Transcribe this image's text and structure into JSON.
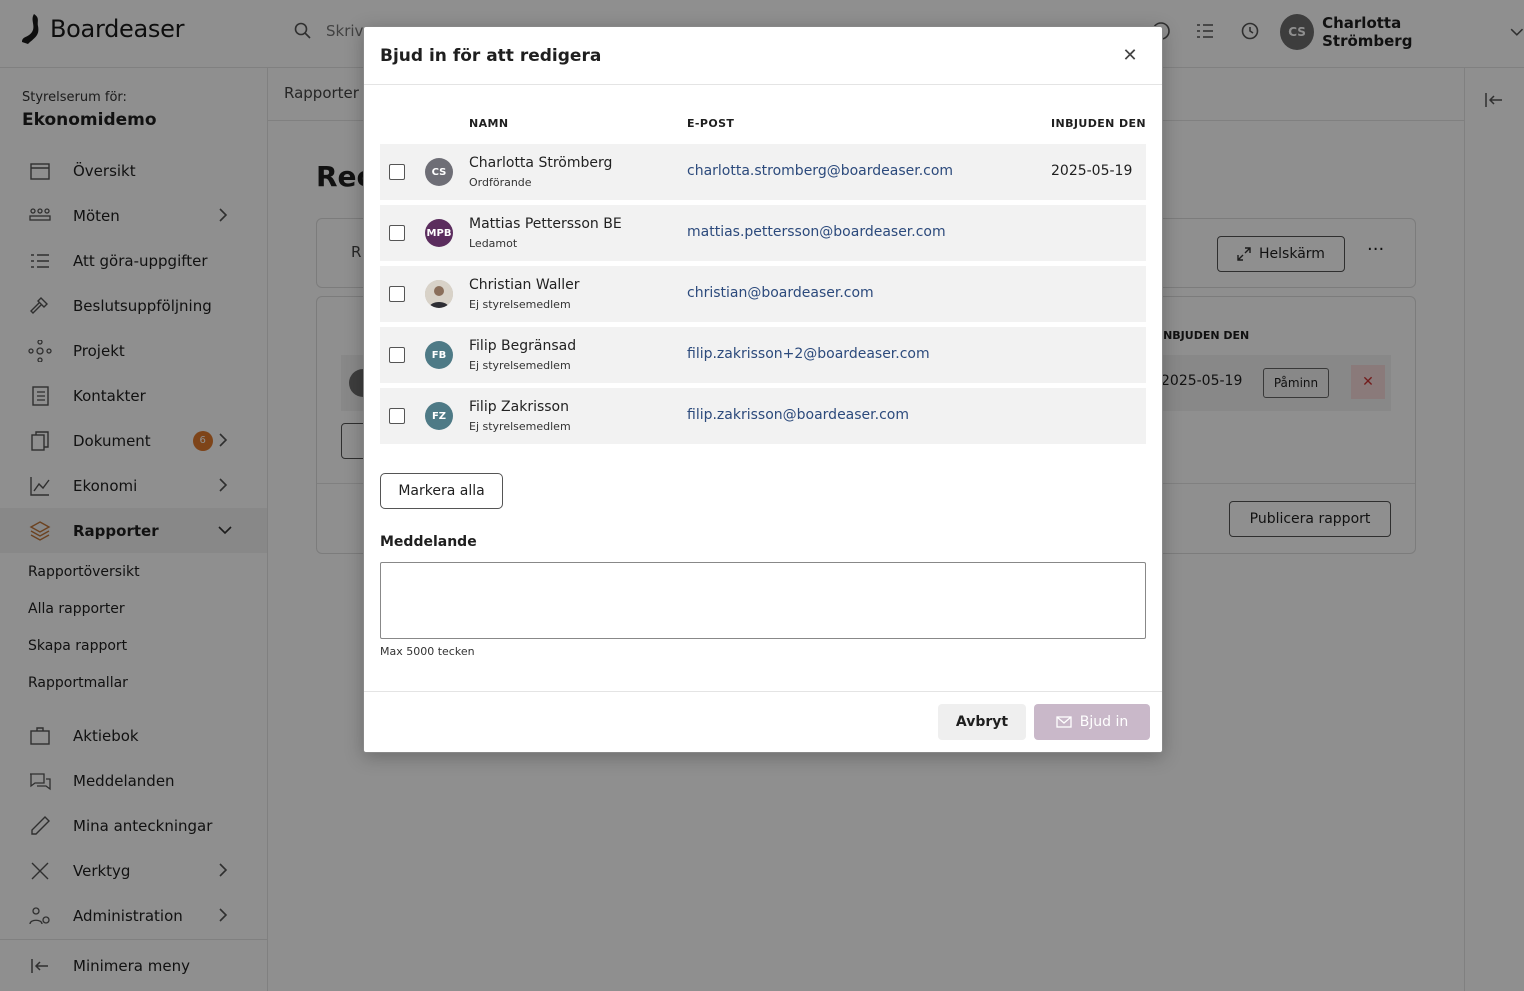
{
  "app": {
    "name": "Boardeaser",
    "search_placeholder": "Skriv"
  },
  "user": {
    "initials": "CS",
    "name": "Charlotta Strömberg"
  },
  "sidebar": {
    "room_label": "Styrelserum för:",
    "room_name": "Ekonomidemo",
    "items": [
      {
        "label": "Översikt",
        "icon": "calendar-icon"
      },
      {
        "label": "Möten",
        "icon": "people-table-icon"
      },
      {
        "label": "Att göra-uppgifter",
        "icon": "checklist-icon"
      },
      {
        "label": "Beslutsuppföljning",
        "icon": "gavel-icon"
      },
      {
        "label": "Projekt",
        "icon": "network-icon"
      },
      {
        "label": "Kontakter",
        "icon": "contacts-icon"
      },
      {
        "label": "Dokument",
        "icon": "documents-icon",
        "badge": "6"
      },
      {
        "label": "Ekonomi",
        "icon": "chart-line-icon"
      },
      {
        "label": "Rapporter",
        "icon": "layers-icon"
      },
      {
        "label": "Aktiebok",
        "icon": "briefcase-icon"
      },
      {
        "label": "Meddelanden",
        "icon": "chat-icon"
      },
      {
        "label": "Mina anteckningar",
        "icon": "pencil-icon"
      },
      {
        "label": "Verktyg",
        "icon": "tools-icon"
      },
      {
        "label": "Administration",
        "icon": "admin-users-icon"
      }
    ],
    "sub_items": [
      "Rapportöversikt",
      "Alla rapporter",
      "Skapa rapport",
      "Rapportmallar"
    ],
    "minimize_label": "Minimera meny"
  },
  "background": {
    "breadcrumb": "Rapporter",
    "page_title": "Rec",
    "card_label": "R",
    "fullscreen_label": "Helskärm",
    "invited_header": "INBJUDEN DEN",
    "invited_date": "2025-05-19",
    "remind_label": "Påminn",
    "publish_label": "Publicera rapport"
  },
  "modal": {
    "title": "Bjud in för att redigera",
    "columns": {
      "name": "NAMN",
      "email": "E-POST",
      "invited": "INBJUDEN DEN"
    },
    "rows": [
      {
        "initials": "CS",
        "name": "Charlotta Strömberg",
        "role": "Ordförande",
        "email": "charlotta.stromberg@boardeaser.com",
        "invited": "2025-05-19",
        "avatar_color": "#6e6e76"
      },
      {
        "initials": "MPB",
        "name": "Mattias Pettersson BE",
        "role": "Ledamot",
        "email": "mattias.pettersson@boardeaser.com",
        "invited": "",
        "avatar_color": "#5b2d5e"
      },
      {
        "initials": "",
        "name": "Christian Waller",
        "role": "Ej styrelsemedlem",
        "email": "christian@boardeaser.com",
        "invited": "",
        "avatar_color": "#c8c0b4"
      },
      {
        "initials": "FB",
        "name": "Filip Begränsad",
        "role": "Ej styrelsemedlem",
        "email": "filip.zakrisson+2@boardeaser.com",
        "invited": "",
        "avatar_color": "#4e7a86"
      },
      {
        "initials": "FZ",
        "name": "Filip Zakrisson",
        "role": "Ej styrelsemedlem",
        "email": "filip.zakrisson@boardeaser.com",
        "invited": "",
        "avatar_color": "#4e7a86"
      }
    ],
    "mark_all_label": "Markera alla",
    "message_label": "Meddelande",
    "message_value": "",
    "message_hint": "Max 5000 tecken",
    "cancel_label": "Avbryt",
    "invite_label": "Bjud in"
  }
}
